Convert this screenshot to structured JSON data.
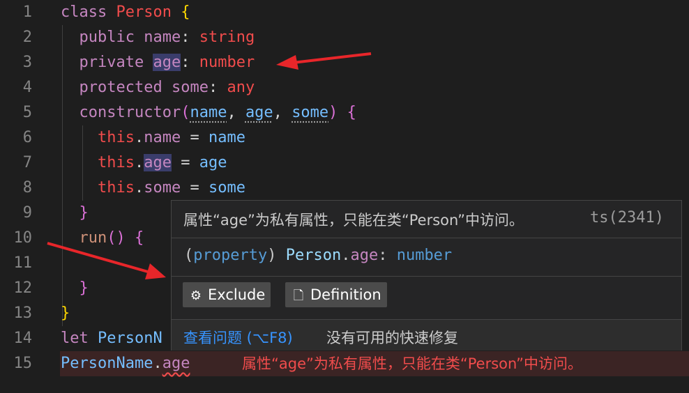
{
  "editor": {
    "line_numbers": [
      "1",
      "2",
      "3",
      "4",
      "5",
      "6",
      "7",
      "8",
      "9",
      "10",
      "11",
      "12",
      "13",
      "14",
      "15"
    ],
    "lines": {
      "l1_class": "class",
      "l1_name": "Person",
      "l1_brace": "{",
      "l2_kw": "public",
      "l2_prop": "name",
      "l2_colon": ":",
      "l2_type": "string",
      "l3_kw": "private",
      "l3_prop": "age",
      "l3_colon": ":",
      "l3_type": "number",
      "l4_kw": "protected",
      "l4_prop": "some",
      "l4_colon": ":",
      "l4_type": "any",
      "l5_fn": "constructor",
      "l5_open": "(",
      "l5_p1": "name",
      "l5_c1": ",",
      "l5_p2": "age",
      "l5_c2": ",",
      "l5_p3": "some",
      "l5_close": ")",
      "l5_brace": "{",
      "l6_this": "this",
      "l6_dot": ".",
      "l6_prop": "name",
      "l6_eq": " = ",
      "l6_val": "name",
      "l7_this": "this",
      "l7_dot": ".",
      "l7_prop": "age",
      "l7_eq": " = ",
      "l7_val": "age",
      "l8_this": "this",
      "l8_dot": ".",
      "l8_prop": "some",
      "l8_eq": " = ",
      "l8_val": "some",
      "l9_brace": "}",
      "l10_fn": "run",
      "l10_paren": "()",
      "l10_brace": "{",
      "l12_brace": "}",
      "l13_brace": "}",
      "l14_let": "let",
      "l14_var": "PersonN",
      "l15_obj": "PersonName",
      "l15_dot": ".",
      "l15_prop": "age"
    },
    "inline_error": "属性“age”为私有属性，只能在类“Person”中访问。"
  },
  "hover": {
    "message": "属性“age”为私有属性，只能在类“Person”中访问。",
    "code": "ts(2341)",
    "sig_open": "(",
    "sig_kind": "property",
    "sig_close": ")",
    "sig_class": "Person",
    "sig_dot": ".",
    "sig_prop": "age",
    "sig_colon": ":",
    "sig_type": "number",
    "exclude_label": "Exclude",
    "definition_label": "Definition",
    "view_problem": "查看问题 (⌥F8)",
    "no_fix": "没有可用的快速修复"
  },
  "colors": {
    "background": "#1e1e1e",
    "error": "#f14c4c",
    "keyword": "#c586c0",
    "link": "#3794ff"
  }
}
